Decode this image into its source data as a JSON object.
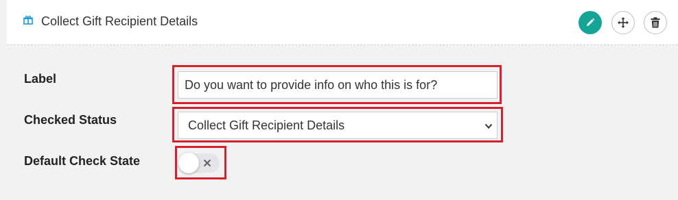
{
  "header": {
    "title": "Collect Gift Recipient Details",
    "gift_icon": "gift-icon",
    "edit_icon": "pencil-icon",
    "move_icon": "move-arrows-icon",
    "delete_icon": "trash-icon"
  },
  "form": {
    "label_field": {
      "label": "Label",
      "value": "Do you want to provide info on who this is for?"
    },
    "checked_status": {
      "label": "Checked Status",
      "selected": "Collect Gift Recipient Details"
    },
    "default_check_state": {
      "label": "Default Check State",
      "on": false
    }
  },
  "colors": {
    "accent": "#14a596",
    "highlight": "#d71e2b"
  }
}
